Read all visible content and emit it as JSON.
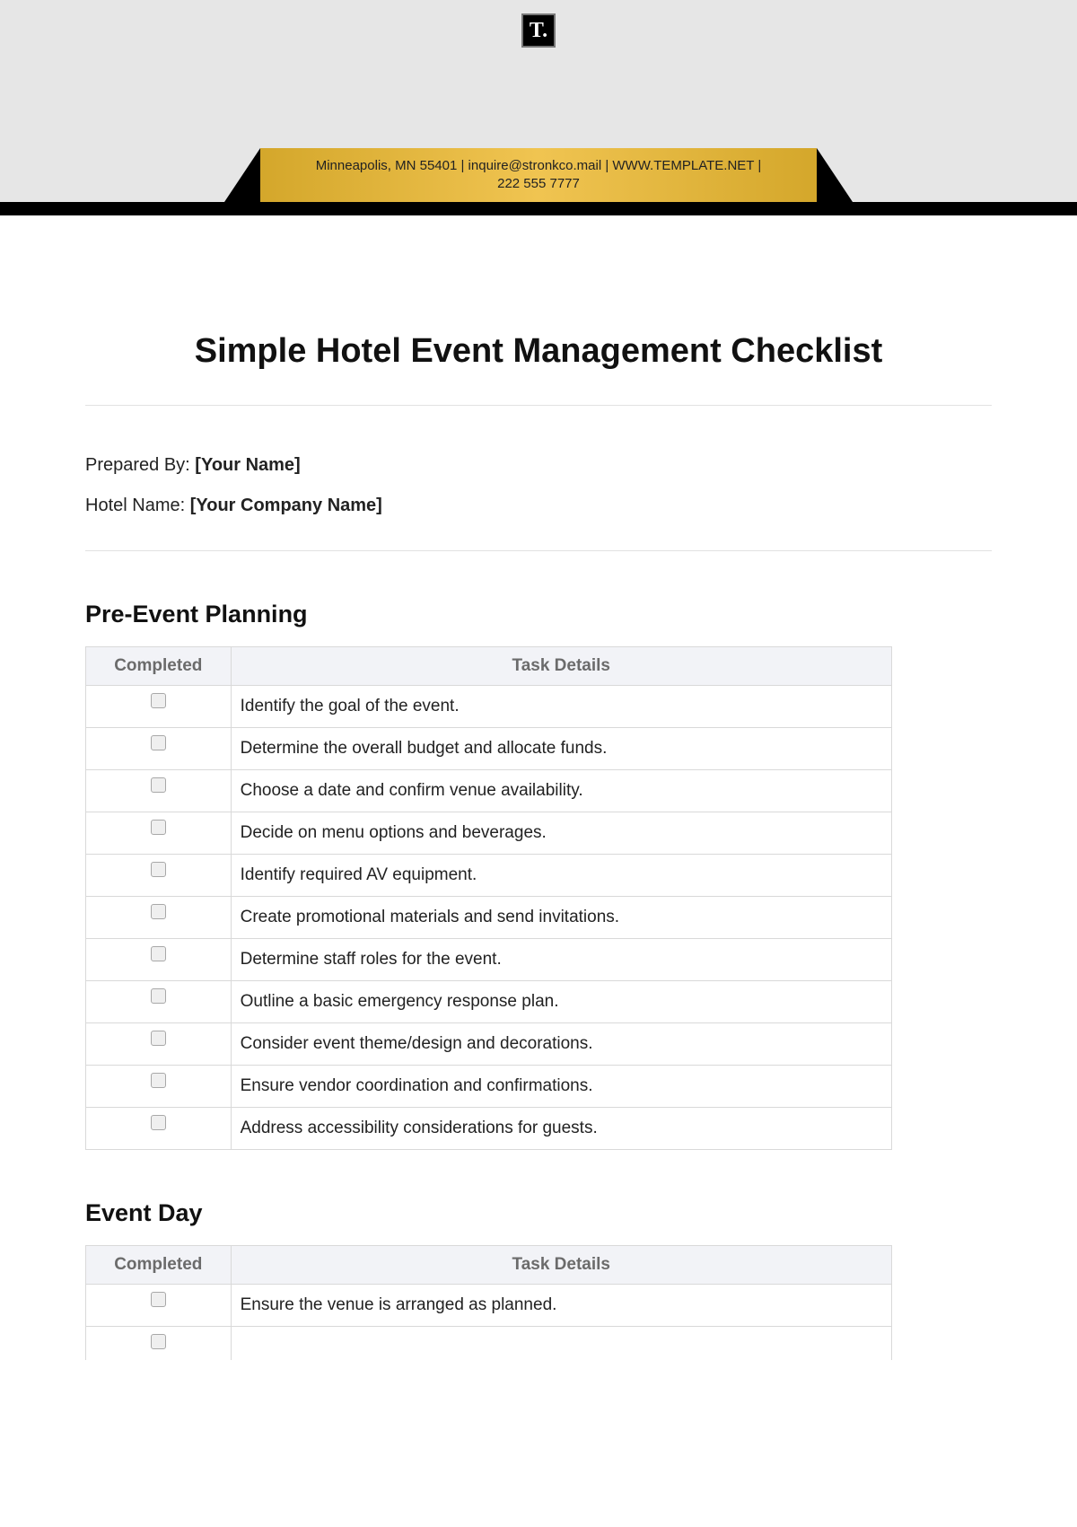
{
  "logo_text": "T.",
  "banner": {
    "line1": "Minneapolis, MN 55401 | inquire@stronkco.mail | WWW.TEMPLATE.NET |",
    "line2": "222 555 7777"
  },
  "title": "Simple Hotel Event Management Checklist",
  "meta": {
    "prepared_label": "Prepared By: ",
    "prepared_value": "[Your Name]",
    "hotel_label": "Hotel Name: ",
    "hotel_value": "[Your Company Name]"
  },
  "columns": {
    "completed": "Completed",
    "details": "Task Details"
  },
  "sections": [
    {
      "heading": "Pre-Event Planning",
      "tasks": [
        "Identify the goal of the event.",
        "Determine the overall budget and allocate funds.",
        "Choose a date and confirm venue availability.",
        "Decide on menu options and beverages.",
        "Identify required AV equipment.",
        "Create promotional materials and send invitations.",
        "Determine staff roles for the event.",
        "Outline a basic emergency response plan.",
        "Consider event theme/design and decorations.",
        "Ensure vendor coordination and confirmations.",
        "Address accessibility considerations for guests."
      ]
    },
    {
      "heading": "Event Day",
      "tasks": [
        "Ensure the venue is arranged as planned."
      ]
    }
  ]
}
